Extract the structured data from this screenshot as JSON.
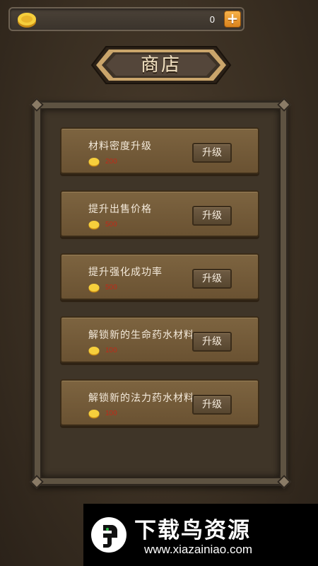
{
  "currency": {
    "icon": "gold-coin-icon",
    "amount": "0",
    "add_icon": "plus-icon",
    "add_label": "+"
  },
  "shop": {
    "title": "商店",
    "items": [
      {
        "name": "材料密度升级",
        "cost": "200",
        "button": "升级"
      },
      {
        "name": "提升出售价格",
        "cost": "500",
        "button": "升级"
      },
      {
        "name": "提升强化成功率",
        "cost": "500",
        "button": "升级"
      },
      {
        "name": "解锁新的生命药水材料",
        "cost": "100",
        "button": "升级"
      },
      {
        "name": "解锁新的法力药水材料",
        "cost": "100",
        "button": "升级"
      }
    ]
  },
  "watermark": {
    "title": "下载鸟资源",
    "url": "www.xiazainiao.com"
  },
  "colors": {
    "cost_text": "#c02a18",
    "coin_gold": "#f2c233",
    "plus_button": "#e99a33"
  }
}
